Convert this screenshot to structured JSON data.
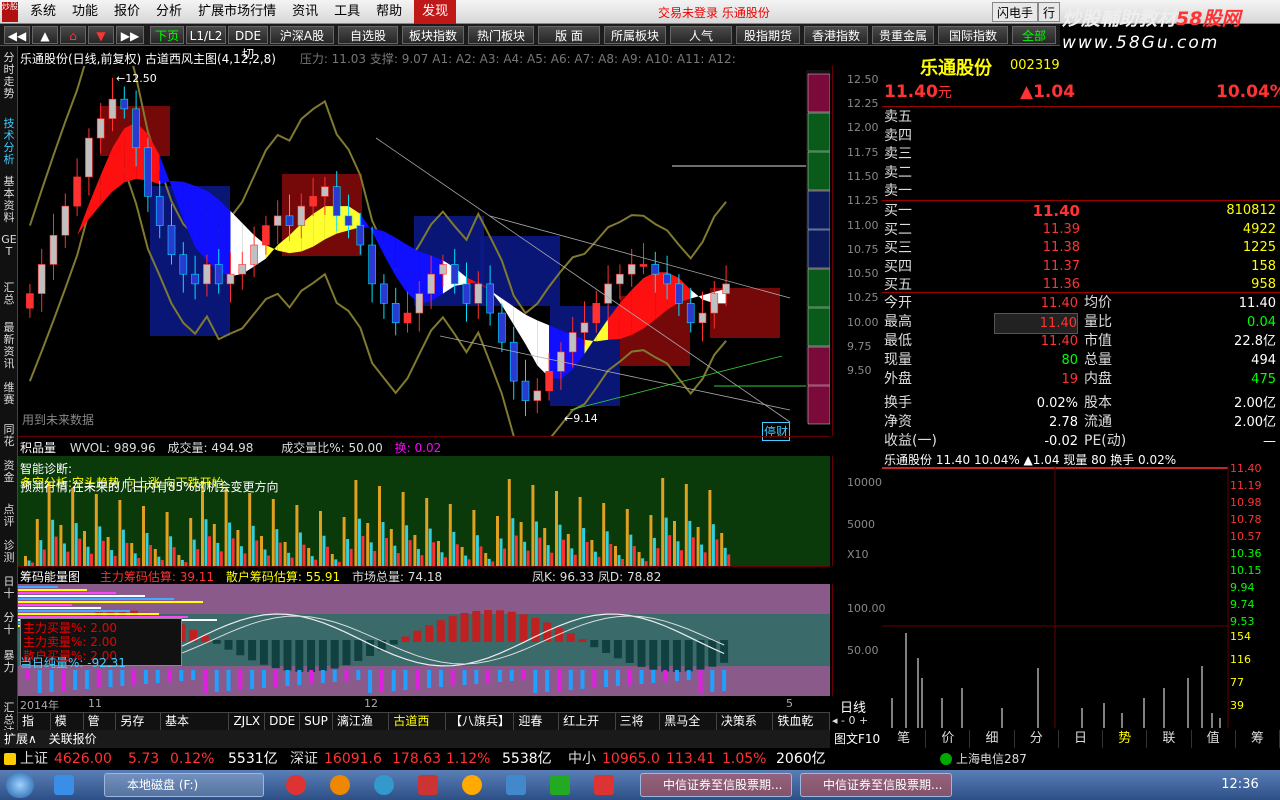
{
  "menu": {
    "logo": "炒股",
    "items": [
      "系统",
      "功能",
      "报价",
      "分析",
      "扩展市场行情",
      "资讯",
      "工具",
      "帮助"
    ],
    "active": "发现",
    "center_text": "交易未登录  乐通股份",
    "right": [
      "闪电手",
      "行"
    ]
  },
  "watermark": {
    "line1": "炒股輔助教材",
    "brand": "58股网",
    "line2": "www.58Gu.com"
  },
  "toolbar": [
    "下页",
    "L1/L2",
    "DDE切",
    "沪深A股",
    "自选股",
    "板块指数",
    "热门板块",
    "版 面",
    "所属板块",
    "人气",
    "股指期货",
    "香港指数",
    "贵重金属",
    "国际指数",
    "全部"
  ],
  "left_tabs": [
    "分时走势",
    "技术分析",
    "基本资料",
    "GET",
    "汇总",
    "最新资讯",
    "维赛",
    "同花",
    "资金",
    "点评",
    "诊测",
    "日十",
    "分十",
    "暴力",
    "汇总注明"
  ],
  "main_chart": {
    "header_left": "乐通股份(日线,前复权) 古道西风主图(4,12,2,8)",
    "header_right": "压力: 11.03 支撑: 9.07 A1: A2: A3: A4: A5: A6: A7: A8: A9: A10: A11: A12:",
    "y_axis": [
      "12.50",
      "12.25",
      "12.00",
      "11.75",
      "11.50",
      "11.25",
      "11.00",
      "10.75",
      "10.50",
      "10.25",
      "10.00",
      "9.75",
      "9.50"
    ],
    "high_label": "12.50",
    "low_label": "9.14",
    "future_note": "用到未来数据",
    "badge": "停财"
  },
  "volume_panel": {
    "title": "积品量",
    "wvol": "WVOL: 989.96",
    "vol": "成交量: 494.98",
    "ratio": "成交量比%: 50.00",
    "extra": "换: 0.02",
    "diag_title": "智能诊断:",
    "diag_line1": "多空分析:空头趋势 向上涨 向下跌开始",
    "diag_line2": "预测行情,在未来的几日内有85%的机会变更方向",
    "y_axis": [
      "10000",
      "5000",
      "X10"
    ]
  },
  "chip_panel": {
    "title": "筹码能量图",
    "main": "主力筹码估算: 39.11",
    "retail": "散户筹码估算: 55.91",
    "cap": "市场总量: 74.18",
    "kd": "凤K: 96.33 凤D: 78.82",
    "box_lines": [
      "主力买量%: 2.00",
      "主力卖量%: 2.00",
      "散户买量%: 2.00"
    ],
    "net": "当日纯量%: -92.31",
    "y_axis": [
      "100.00",
      "50.00"
    ],
    "date_left": "2014年",
    "date_mid": "11",
    "date_right": "12",
    "date_end": "5"
  },
  "bottom_tabs": [
    "指标",
    "模板",
    "管理",
    "另存为",
    "基本MACD",
    "ZJLX",
    "DDE",
    "SUP",
    "漓江渔歌",
    "古道西风",
    "【八旗兵】",
    "迎春图",
    "红上开花",
    "三将军",
    "黑马全息",
    "决策系统",
    "铁血乾坤"
  ],
  "bottom_active": "古道西风",
  "expand_bar": {
    "a": "扩展∧",
    "b": "关联报价",
    "c": "日线",
    "d": "图文F10"
  },
  "quote": {
    "name": "乐通股份",
    "code": "002319",
    "price": "11.40",
    "unit": "元",
    "change": "▲1.04",
    "pct": "10.04%",
    "sells": [
      {
        "label": "卖五",
        "price": "",
        "vol": ""
      },
      {
        "label": "卖四",
        "price": "",
        "vol": ""
      },
      {
        "label": "卖三",
        "price": "",
        "vol": ""
      },
      {
        "label": "卖二",
        "price": "",
        "vol": ""
      },
      {
        "label": "卖一",
        "price": "",
        "vol": ""
      }
    ],
    "buys": [
      {
        "label": "买一",
        "price": "11.40",
        "vol": "810812"
      },
      {
        "label": "买二",
        "price": "11.39",
        "vol": "4922"
      },
      {
        "label": "买三",
        "price": "11.38",
        "vol": "1225"
      },
      {
        "label": "买四",
        "price": "11.37",
        "vol": "158"
      },
      {
        "label": "买五",
        "price": "11.36",
        "vol": "958"
      }
    ],
    "stats": [
      [
        "今开",
        "11.40",
        "均价",
        "11.40"
      ],
      [
        "最高",
        "11.40",
        "量比",
        "0.04"
      ],
      [
        "最低",
        "11.40",
        "市值",
        "22.8亿"
      ],
      [
        "现量",
        "80",
        "总量",
        "494"
      ],
      [
        "外盘",
        "19",
        "内盘",
        "475"
      ],
      [
        "换手",
        "0.02%",
        "股本",
        "2.00亿"
      ],
      [
        "净资",
        "2.78",
        "流通",
        "2.00亿"
      ],
      [
        "收益(一)",
        "-0.02",
        "PE(动)",
        "—"
      ]
    ],
    "mini_header": "乐通股份  11.40 10.04% ▲1.04 现量 80 换手 0.02%",
    "mini_price_axis": [
      "11.40",
      "11.19",
      "10.98",
      "10.78",
      "10.57",
      "10.36",
      "10.15",
      "9.94",
      "9.74",
      "9.53"
    ],
    "mini_vol_axis": [
      "154",
      "116",
      "77",
      "39"
    ]
  },
  "right_tabs": [
    "笔",
    "价",
    "细",
    "分",
    "日",
    "势",
    "联",
    "值",
    "筹"
  ],
  "ticker": {
    "sh_label": "上证",
    "sh_val": "4626.00",
    "sh_chg": "5.73",
    "sh_pct": "0.12%",
    "sh_amt": "5531亿",
    "sz_label": "深证",
    "sz_val": "16091.6",
    "sz_chg": "178.63",
    "sz_pct": "1.12%",
    "sz_amt": "5538亿",
    "zx_label": "中小",
    "zx_val": "10965.0",
    "zx_chg": "113.41",
    "zx_pct": "1.05%",
    "zx_amt": "2060亿",
    "right": "上海电信287"
  },
  "taskbar": {
    "tasks": [
      "本地磁盘 (F:)",
      "中信证券至信股票期...",
      "中信证券至信股票期..."
    ],
    "clock": "12:36"
  },
  "colors": {
    "up": "#ff3333",
    "down": "#00ffff",
    "green": "#00d000",
    "yellow": "#ffff00"
  }
}
